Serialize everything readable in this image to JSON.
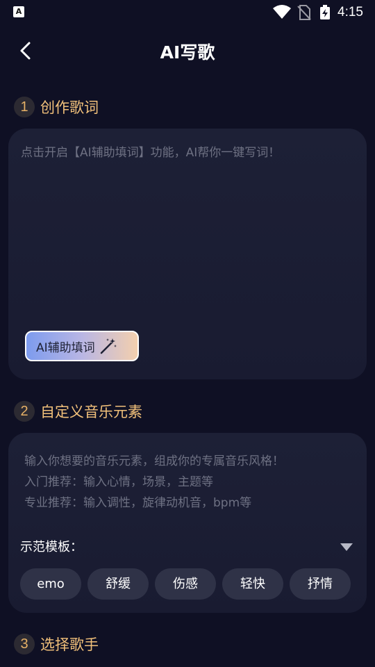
{
  "status_bar": {
    "app_icon_letter": "A",
    "time": "4:15"
  },
  "header": {
    "title": "AI写歌"
  },
  "sections": [
    {
      "number": "1",
      "title": "创作歌词"
    },
    {
      "number": "2",
      "title": "自定义音乐元素"
    },
    {
      "number": "3",
      "title": "选择歌手"
    }
  ],
  "lyrics": {
    "placeholder": "点击开启【AI辅助填词】功能，AI帮你一键写词！",
    "ai_button_label": "AI辅助填词"
  },
  "elements": {
    "placeholder_lines": [
      "输入你想要的音乐元素，组成你的专属音乐风格！",
      "入门推荐：输入心情，场景，主题等",
      "专业推荐：输入调性，旋律动机音，bpm等"
    ],
    "template_label": "示范模板：",
    "chips": [
      "emo",
      "舒缓",
      "伤感",
      "轻快",
      "抒情"
    ]
  },
  "colors": {
    "background": "#0f1024",
    "accent_gold": "#f1c07a",
    "card": "#1d2036",
    "chip": "#2f3247"
  },
  "icons": {
    "back": "chevron-left-icon",
    "wand": "magic-wand-icon",
    "dropdown": "triangle-down-icon"
  }
}
